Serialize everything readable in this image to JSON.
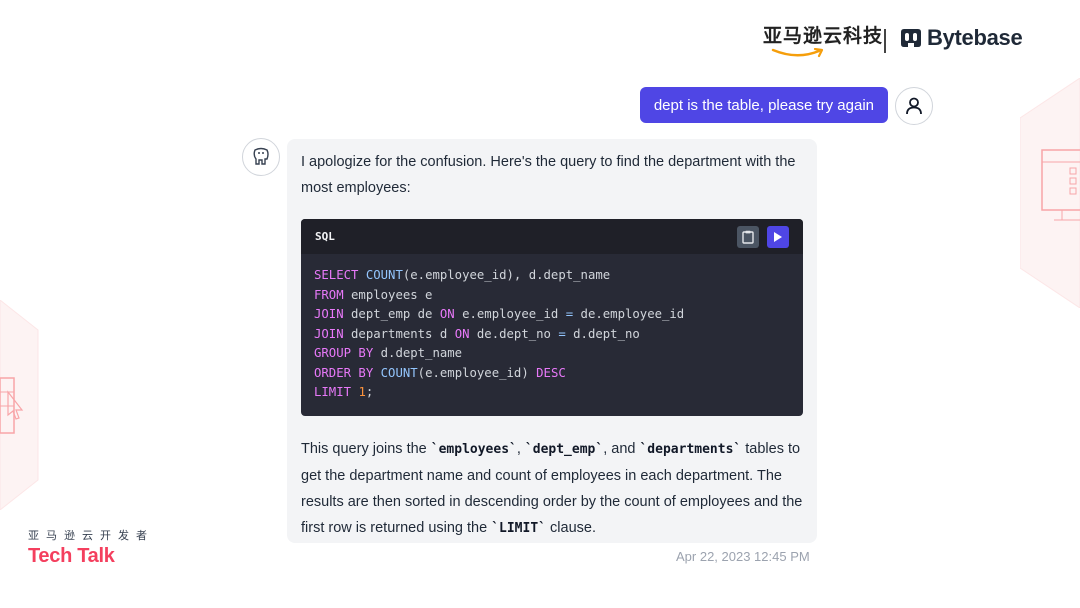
{
  "header": {
    "amazon_logo_text": "亚马逊云科技",
    "bytebase_logo_text": "Bytebase"
  },
  "user_message": {
    "text": "dept is the table, please try again"
  },
  "bot_message": {
    "intro": "I apologize for the confusion. Here's the query to find the department with the most employees:",
    "code": {
      "language": "SQL",
      "lines": [
        [
          {
            "t": "SELECT ",
            "c": "kw"
          },
          {
            "t": "COUNT",
            "c": "fn"
          },
          {
            "t": "(e.employee_id), d.dept_name",
            "c": ""
          }
        ],
        [
          {
            "t": "FROM",
            "c": "kw"
          },
          {
            "t": " employees e",
            "c": ""
          }
        ],
        [
          {
            "t": "JOIN",
            "c": "kw"
          },
          {
            "t": " dept_emp de ",
            "c": ""
          },
          {
            "t": "ON",
            "c": "kw"
          },
          {
            "t": " e.employee_id ",
            "c": ""
          },
          {
            "t": "=",
            "c": "fn"
          },
          {
            "t": " de.employee_id",
            "c": ""
          }
        ],
        [
          {
            "t": "JOIN",
            "c": "kw"
          },
          {
            "t": " departments d ",
            "c": ""
          },
          {
            "t": "ON",
            "c": "kw"
          },
          {
            "t": " de.dept_no ",
            "c": ""
          },
          {
            "t": "=",
            "c": "fn"
          },
          {
            "t": " d.dept_no",
            "c": ""
          }
        ],
        [
          {
            "t": "GROUP BY",
            "c": "kw"
          },
          {
            "t": " d.dept_name",
            "c": ""
          }
        ],
        [
          {
            "t": "ORDER BY",
            "c": "kw"
          },
          {
            "t": " ",
            "c": ""
          },
          {
            "t": "COUNT",
            "c": "fn"
          },
          {
            "t": "(e.employee_id) ",
            "c": ""
          },
          {
            "t": "DESC",
            "c": "kw"
          }
        ],
        [
          {
            "t": "LIMIT",
            "c": "kw"
          },
          {
            "t": " ",
            "c": ""
          },
          {
            "t": "1",
            "c": "num"
          },
          {
            "t": ";",
            "c": ""
          }
        ]
      ]
    },
    "outro": {
      "part1": "This query joins the ",
      "code1": "`employees`",
      "part2": ", ",
      "code2": "`dept_emp`",
      "part3": ", and ",
      "code3": "`departments`",
      "part4": " tables to get the department name and count of employees in each department. The results are then sorted in descending order by the count of employees and the first row is returned using the ",
      "code4": "`LIMIT`",
      "part5": " clause."
    },
    "timestamp": "Apr 22, 2023 12:45 PM"
  },
  "branding": {
    "cn_text": "亚马逊云开发者",
    "tech_talk": "Tech Talk"
  },
  "colors": {
    "accent": "#4f46e5",
    "brand_pink": "#f43f5e",
    "code_bg": "#282a36"
  }
}
